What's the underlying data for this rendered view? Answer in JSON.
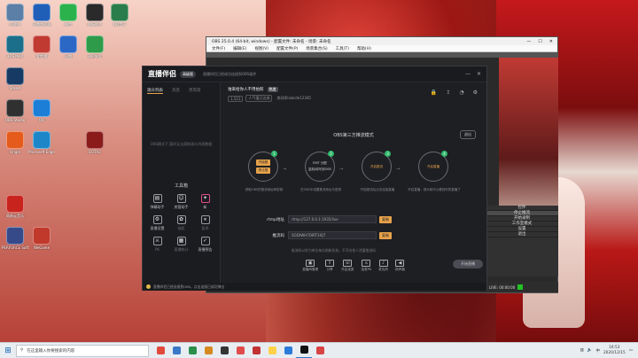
{
  "desktop_icons": [
    {
      "label": "回收站",
      "icon": "recycle-bin-icon",
      "color": "#5b7fa6"
    },
    {
      "label": "迅雷加速器",
      "icon": "thunder-icon",
      "color": "#1f5fb8"
    },
    {
      "label": "微信",
      "icon": "wechat-icon",
      "color": "#2bb24c"
    },
    {
      "label": "图标助手",
      "icon": "helper-icon",
      "color": "#2a2a2a"
    },
    {
      "label": "QQ音乐",
      "icon": "music-icon",
      "color": "#2a7d4a"
    },
    {
      "label": "3DS MAX",
      "icon": "max-icon",
      "color": "#1c6f8a"
    },
    {
      "label": "爱剪辑",
      "icon": "editor-icon",
      "color": "#c13a32"
    },
    {
      "label": "迅雷",
      "icon": "thunder2-icon",
      "color": "#2b68c6"
    },
    {
      "label": "360安全",
      "icon": "shield-icon",
      "color": "#2e9b4a"
    },
    {
      "label": "Steam",
      "icon": "steam-icon",
      "color": "#163a63"
    },
    {
      "label": "OBS Studio",
      "icon": "obs-icon",
      "color": "#303030"
    },
    {
      "label": "QQ",
      "icon": "qq-icon",
      "color": "#1c7ed6"
    },
    {
      "label": "Origin",
      "icon": "origin-icon",
      "color": "#e45b1c"
    },
    {
      "label": "Microsoft Edge",
      "icon": "edge-icon",
      "color": "#1d86c8"
    },
    {
      "label": "DOTA2",
      "icon": "game-icon",
      "color": "#8b1a1a"
    },
    {
      "label": "网易云音乐",
      "icon": "netease-icon",
      "color": "#c9231e"
    },
    {
      "label": "PERFORCE Software",
      "icon": "perforce-icon",
      "color": "#364a8a"
    },
    {
      "label": "WeGame",
      "icon": "wegame-icon",
      "color": "#c0392b"
    }
  ],
  "obs": {
    "title": "OBS 25.0.4 (64-bit, windows) - 配置文件: 未命名 - 场景: 未命名",
    "menu": [
      "文件(F)",
      "编辑(E)",
      "视图(V)",
      "配置文件(P)",
      "场景集合(S)",
      "工具(T)",
      "帮助(H)"
    ],
    "controls_label": "控件",
    "controls": [
      "停止推流",
      "开始录制",
      "工作室模式",
      "设置",
      "退出"
    ],
    "status": [
      "LIVE: 00:00:00",
      "REC: 00:00:00",
      "CPU: 0.4%, 30.00 fps"
    ]
  },
  "plugin": {
    "logo": "直播伴侣",
    "version": "高级版",
    "subtitle": "直播伴侣已经成功连接到OBS插件",
    "left_tabs": [
      "观众列表",
      "消息",
      "贵宾席"
    ],
    "empty_text": "OBS模式下,暂时无法获取观众列表数据",
    "tools_title": "工具箱",
    "tools": [
      {
        "label": "弹幕助手",
        "icon": "danmaku-icon",
        "dim": false
      },
      {
        "label": "房管助手",
        "icon": "admin-icon",
        "dim": false
      },
      {
        "label": "新",
        "icon": "new-icon",
        "dim": false
      },
      {
        "label": "直播设置",
        "icon": "setting-icon",
        "dim": false
      },
      {
        "label": "抽奖",
        "icon": "lottery-icon",
        "dim": true
      },
      {
        "label": "暂停",
        "icon": "pause-icon",
        "dim": true
      },
      {
        "label": "PK",
        "icon": "pk-icon",
        "dim": true
      },
      {
        "label": "直播统计",
        "icon": "stats-icon",
        "dim": true
      },
      {
        "label": "直播预告",
        "icon": "preview-icon",
        "dim": false
      }
    ],
    "room_title": "谁来给你人不用拍照",
    "room_tag": "热度",
    "room_badges": [
      "1,521",
      "人气值已达成"
    ],
    "room_id": "房间ID:abcde12345",
    "mode_title": "OBS第三方推流模式",
    "switch_label": "退出",
    "steps": [
      {
        "num": "1",
        "buttons": [
          "开始推",
          "停止推"
        ],
        "caption": "获取OBS的推流地址和密钥"
      },
      {
        "num": "2",
        "buttons": [],
        "text": [
          "RMT 分配",
          "复制/填写到OBS"
        ],
        "caption": "在OBS中设置推流地址与密钥"
      },
      {
        "num": "3",
        "buttons": [],
        "text": [
          "开启推流"
        ],
        "caption": "开始推流后点击连接直播"
      },
      {
        "num": "4",
        "buttons": [],
        "text": [
          "开启直播"
        ],
        "caption": "开启直播，观众就可以看到你的直播了"
      }
    ],
    "rtmp_label": "rtmp地址",
    "rtmp_value": "rtmp://127.0.0.1:1935/live",
    "key_label": "推流码",
    "key_value": "SODtWH7DIRT3IQ7",
    "copy": "复制",
    "hint": "推流码以秒为单位每次刷新失效，不可向他人泄露推流码",
    "bottom": [
      {
        "label": "直播间管理",
        "icon": "room-icon"
      },
      {
        "label": "分享",
        "icon": "share-icon"
      },
      {
        "label": "开启连麦",
        "icon": "mic-link-icon"
      },
      {
        "label": "连麦PK",
        "icon": "pk-icon"
      },
      {
        "label": "麦克风",
        "icon": "mic-icon"
      },
      {
        "label": "扬声器",
        "icon": "speaker-icon"
      }
    ],
    "start_button": "开始直播",
    "footer_warning": "直播伴侣已经连接到OBS，点击连接已成功弹出"
  },
  "taskbar": {
    "search_placeholder": "在这里输入你要搜索的内容",
    "apps": [
      "#e14a3b",
      "#3a78c8",
      "#2a8f4a",
      "#d6891f",
      "#343434",
      "#e04b4b",
      "#c23232",
      "#ffd24a",
      "#2b7bd8",
      "#101010",
      "#d84343"
    ],
    "time": "16:53",
    "date": "2020/12/15",
    "ime": "中"
  }
}
